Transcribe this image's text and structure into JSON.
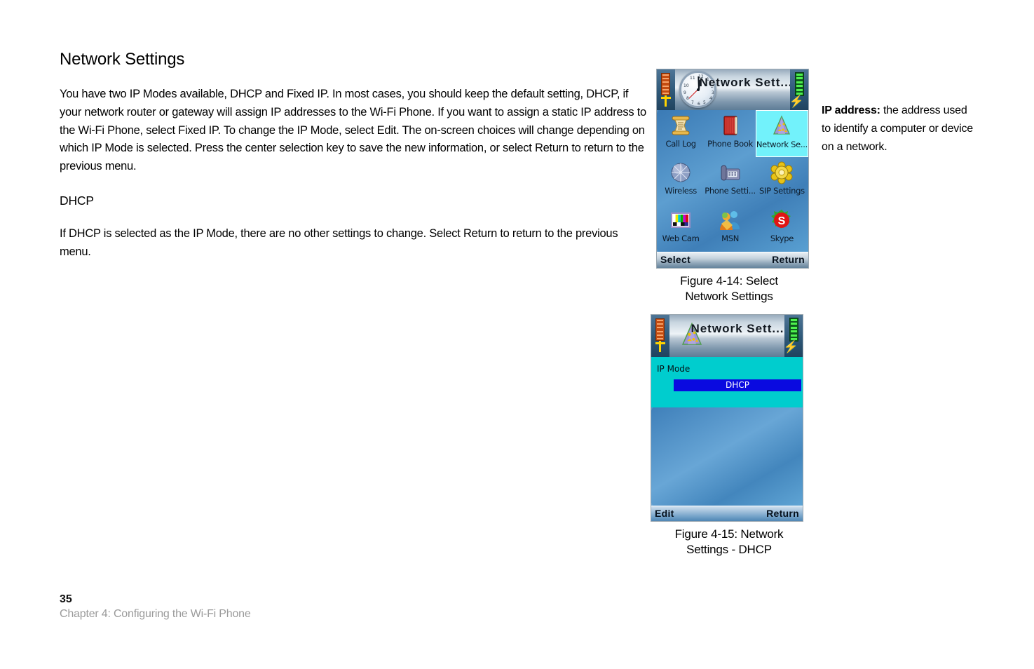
{
  "document": {
    "title": "Network Settings",
    "paragraphs": [
      "You have two IP Modes available, DHCP and Fixed IP. In most cases, you should keep the default setting, DHCP, if your network router or gateway will assign IP addresses to the Wi-Fi Phone. If you want to assign a static IP address to the Wi-Fi Phone, select Fixed IP. To change the IP Mode, select Edit. The on-screen choices will change depending on which IP Mode is selected. Press the center selection key to save the new information, or select Return to return to the previous menu.",
      "If DHCP is selected as the IP Mode, there are no other settings to change. Select Return to return to the previous menu."
    ],
    "subheading": "DHCP"
  },
  "note": {
    "term": "IP address:",
    "definition": " the address used to identify a computer or device on a network."
  },
  "figures": [
    {
      "caption_line1": "Figure 4-14: Select",
      "caption_line2": "Network Settings",
      "screen": {
        "title": "Network Sett...",
        "clock_numbers": [
          "12",
          "1",
          "2",
          "3",
          "4",
          "5",
          "6",
          "7",
          "8",
          "9",
          "10",
          "11"
        ],
        "menu": [
          {
            "label": "Call Log",
            "icon": "scroll-icon",
            "selected": false
          },
          {
            "label": "Phone Book",
            "icon": "red-book-icon",
            "selected": false
          },
          {
            "label": "Network Se...",
            "icon": "network-cone-icon",
            "selected": true
          },
          {
            "label": "Wireless",
            "icon": "globe-icon",
            "selected": false
          },
          {
            "label": "Phone Setti...",
            "icon": "desk-phone-icon",
            "selected": false
          },
          {
            "label": "SIP Settings",
            "icon": "gear-flower-icon",
            "selected": false
          },
          {
            "label": "Web Cam",
            "icon": "color-bars-icon",
            "selected": false
          },
          {
            "label": "MSN",
            "icon": "msn-people-icon",
            "selected": false
          },
          {
            "label": "Skype",
            "icon": "skype-s-icon",
            "selected": false
          }
        ],
        "softkey_left": "Select",
        "softkey_right": "Return"
      }
    },
    {
      "caption_line1": "Figure 4-15: Network",
      "caption_line2": "Settings - DHCP",
      "screen": {
        "title": "Network Sett...",
        "field_label": "IP Mode",
        "field_value": "DHCP",
        "softkey_left": "Edit",
        "softkey_right": "Return"
      }
    }
  ],
  "footer": {
    "page_number": "35",
    "chapter": "Chapter 4: Configuring the Wi-Fi Phone"
  },
  "colors": {
    "selected_cell": "#72f2fb",
    "panel_cyan": "#00cdce",
    "value_blue": "#0a0ae0",
    "signal_orange": "#c34b10",
    "battery_green": "#4ef24e",
    "chapter_gray": "#9a9a9a"
  }
}
